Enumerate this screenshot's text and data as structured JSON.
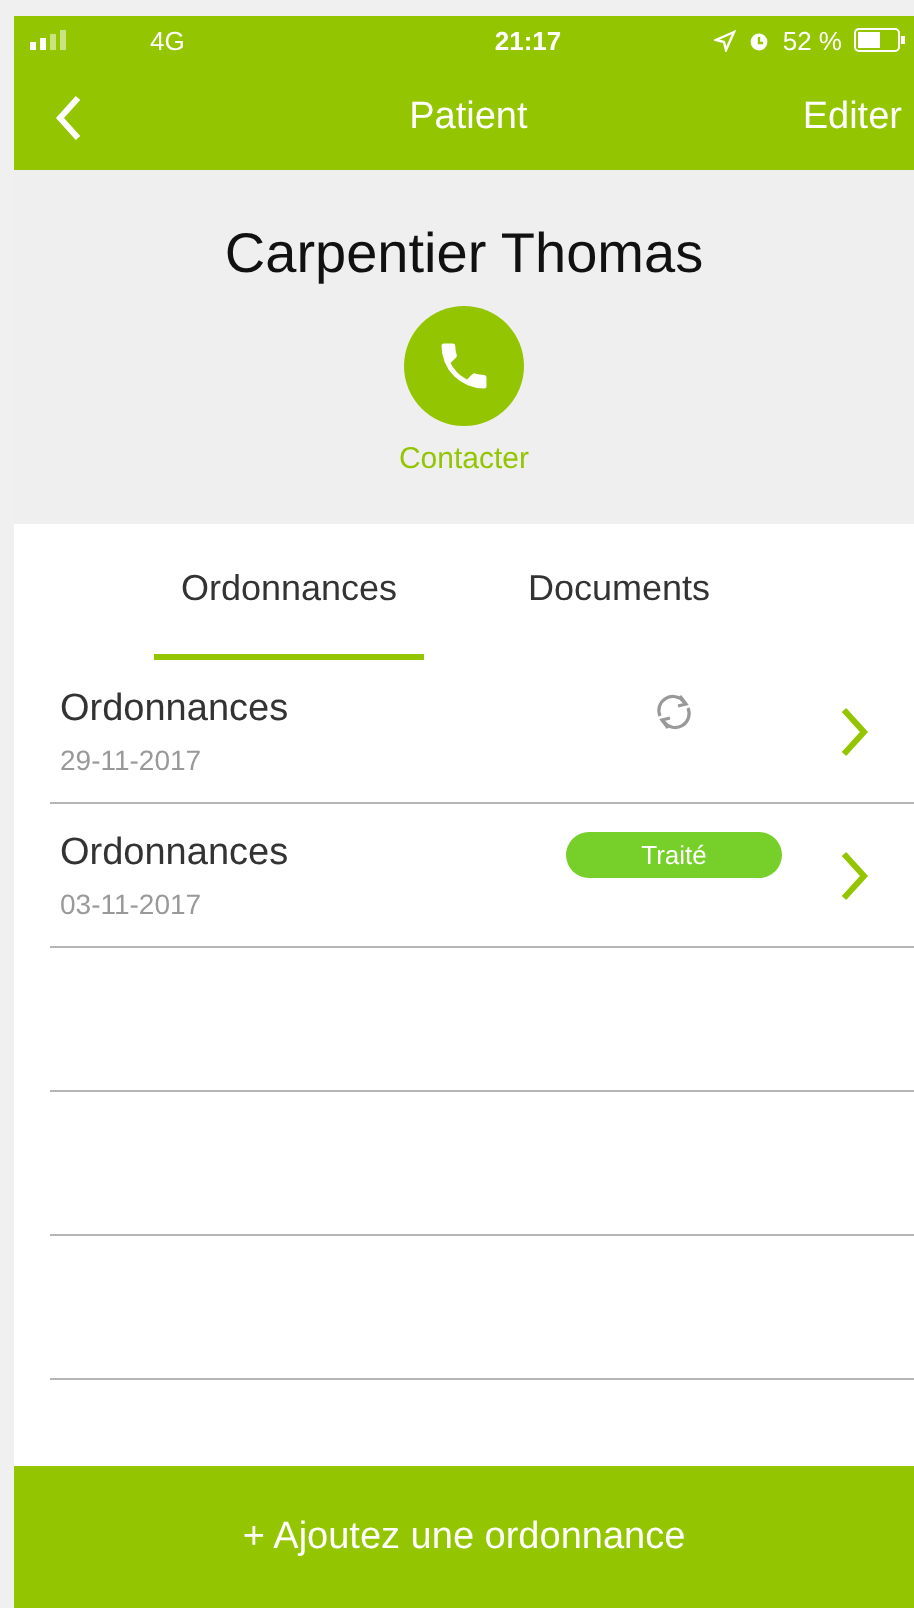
{
  "status_bar": {
    "network": "4G",
    "time": "21:17",
    "battery": "52 %"
  },
  "nav": {
    "title": "Patient",
    "action": "Editer"
  },
  "patient": {
    "name": "Carpentier Thomas",
    "contact_label": "Contacter"
  },
  "tabs": [
    {
      "label": "Ordonnances",
      "selected": true
    },
    {
      "label": "Documents",
      "selected": false
    }
  ],
  "rows": [
    {
      "title": "Ordonnances",
      "date": "29-11-2017",
      "kind": "syncing"
    },
    {
      "title": "Ordonnances",
      "date": "03-11-2017",
      "kind": "status",
      "status": "Traité"
    }
  ],
  "add_button": "+ Ajoutez une ordonnance"
}
